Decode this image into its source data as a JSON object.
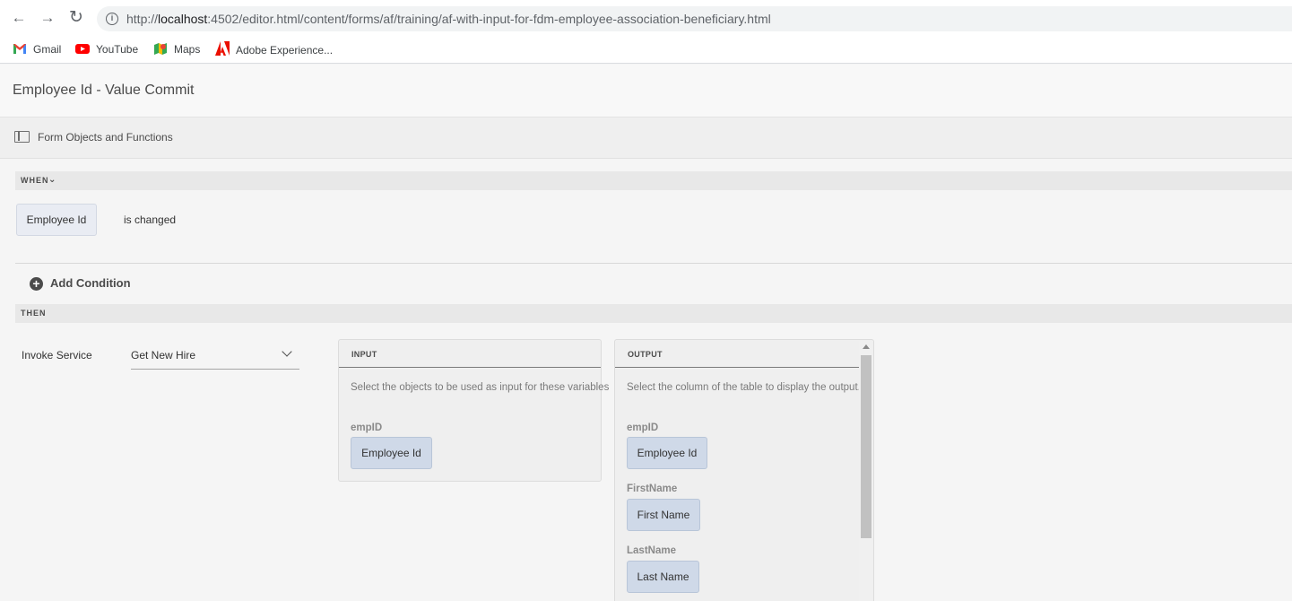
{
  "browser": {
    "url_scheme": "http://",
    "url_host": "localhost",
    "url_rest": ":4502/editor.html/content/forms/af/training/af-with-input-for-fdm-employee-association-beneficiary.html",
    "bookmarks": [
      {
        "label": "Gmail",
        "icon": "gmail-icon"
      },
      {
        "label": "YouTube",
        "icon": "youtube-icon"
      },
      {
        "label": "Maps",
        "icon": "maps-icon"
      },
      {
        "label": "Adobe Experience...",
        "icon": "adobe-icon"
      }
    ]
  },
  "editor": {
    "title": "Employee Id - Value Commit",
    "form_objects_label": "Form Objects and Functions"
  },
  "when": {
    "header": "WHEN",
    "field": "Employee Id",
    "operator": "is changed",
    "add_condition": "Add Condition"
  },
  "then": {
    "header": "THEN",
    "action": "Invoke Service",
    "service": "Get New Hire"
  },
  "input_panel": {
    "header": "INPUT",
    "description": "Select the objects to be used as input for these variables",
    "variables": [
      {
        "name": "empID",
        "value": "Employee Id"
      }
    ]
  },
  "output_panel": {
    "header": "OUTPUT",
    "description": "Select the column of the table to display the output.",
    "variables": [
      {
        "name": "empID",
        "value": "Employee Id"
      },
      {
        "name": "FirstName",
        "value": "First Name"
      },
      {
        "name": "LastName",
        "value": "Last Name"
      }
    ]
  },
  "colors": {
    "token_bg": "#cfd9e8",
    "section_bg": "#e8e8e8",
    "youtube_red": "#ff0000",
    "adobe_red": "#eb1000"
  }
}
